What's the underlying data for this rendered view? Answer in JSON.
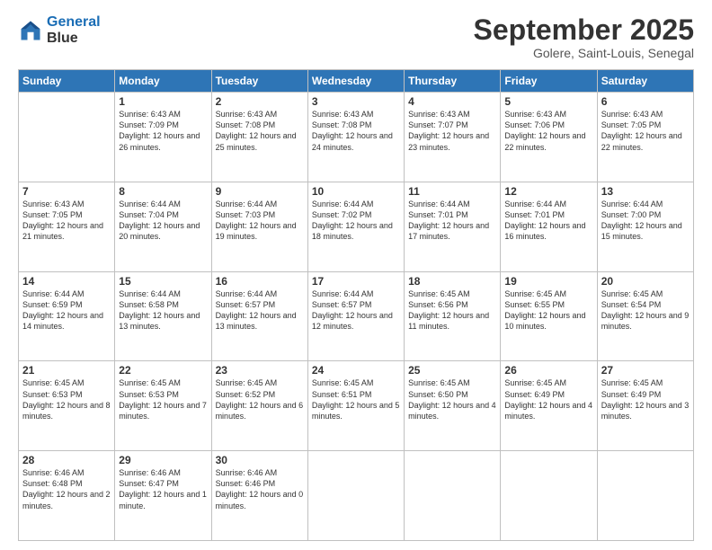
{
  "logo": {
    "line1": "General",
    "line2": "Blue"
  },
  "title": "September 2025",
  "subtitle": "Golere, Saint-Louis, Senegal",
  "days_of_week": [
    "Sunday",
    "Monday",
    "Tuesday",
    "Wednesday",
    "Thursday",
    "Friday",
    "Saturday"
  ],
  "weeks": [
    [
      {
        "day": "",
        "sunrise": "",
        "sunset": "",
        "daylight": ""
      },
      {
        "day": "1",
        "sunrise": "Sunrise: 6:43 AM",
        "sunset": "Sunset: 7:09 PM",
        "daylight": "Daylight: 12 hours and 26 minutes."
      },
      {
        "day": "2",
        "sunrise": "Sunrise: 6:43 AM",
        "sunset": "Sunset: 7:08 PM",
        "daylight": "Daylight: 12 hours and 25 minutes."
      },
      {
        "day": "3",
        "sunrise": "Sunrise: 6:43 AM",
        "sunset": "Sunset: 7:08 PM",
        "daylight": "Daylight: 12 hours and 24 minutes."
      },
      {
        "day": "4",
        "sunrise": "Sunrise: 6:43 AM",
        "sunset": "Sunset: 7:07 PM",
        "daylight": "Daylight: 12 hours and 23 minutes."
      },
      {
        "day": "5",
        "sunrise": "Sunrise: 6:43 AM",
        "sunset": "Sunset: 7:06 PM",
        "daylight": "Daylight: 12 hours and 22 minutes."
      },
      {
        "day": "6",
        "sunrise": "Sunrise: 6:43 AM",
        "sunset": "Sunset: 7:05 PM",
        "daylight": "Daylight: 12 hours and 22 minutes."
      }
    ],
    [
      {
        "day": "7",
        "sunrise": "Sunrise: 6:43 AM",
        "sunset": "Sunset: 7:05 PM",
        "daylight": "Daylight: 12 hours and 21 minutes."
      },
      {
        "day": "8",
        "sunrise": "Sunrise: 6:44 AM",
        "sunset": "Sunset: 7:04 PM",
        "daylight": "Daylight: 12 hours and 20 minutes."
      },
      {
        "day": "9",
        "sunrise": "Sunrise: 6:44 AM",
        "sunset": "Sunset: 7:03 PM",
        "daylight": "Daylight: 12 hours and 19 minutes."
      },
      {
        "day": "10",
        "sunrise": "Sunrise: 6:44 AM",
        "sunset": "Sunset: 7:02 PM",
        "daylight": "Daylight: 12 hours and 18 minutes."
      },
      {
        "day": "11",
        "sunrise": "Sunrise: 6:44 AM",
        "sunset": "Sunset: 7:01 PM",
        "daylight": "Daylight: 12 hours and 17 minutes."
      },
      {
        "day": "12",
        "sunrise": "Sunrise: 6:44 AM",
        "sunset": "Sunset: 7:01 PM",
        "daylight": "Daylight: 12 hours and 16 minutes."
      },
      {
        "day": "13",
        "sunrise": "Sunrise: 6:44 AM",
        "sunset": "Sunset: 7:00 PM",
        "daylight": "Daylight: 12 hours and 15 minutes."
      }
    ],
    [
      {
        "day": "14",
        "sunrise": "Sunrise: 6:44 AM",
        "sunset": "Sunset: 6:59 PM",
        "daylight": "Daylight: 12 hours and 14 minutes."
      },
      {
        "day": "15",
        "sunrise": "Sunrise: 6:44 AM",
        "sunset": "Sunset: 6:58 PM",
        "daylight": "Daylight: 12 hours and 13 minutes."
      },
      {
        "day": "16",
        "sunrise": "Sunrise: 6:44 AM",
        "sunset": "Sunset: 6:57 PM",
        "daylight": "Daylight: 12 hours and 13 minutes."
      },
      {
        "day": "17",
        "sunrise": "Sunrise: 6:44 AM",
        "sunset": "Sunset: 6:57 PM",
        "daylight": "Daylight: 12 hours and 12 minutes."
      },
      {
        "day": "18",
        "sunrise": "Sunrise: 6:45 AM",
        "sunset": "Sunset: 6:56 PM",
        "daylight": "Daylight: 12 hours and 11 minutes."
      },
      {
        "day": "19",
        "sunrise": "Sunrise: 6:45 AM",
        "sunset": "Sunset: 6:55 PM",
        "daylight": "Daylight: 12 hours and 10 minutes."
      },
      {
        "day": "20",
        "sunrise": "Sunrise: 6:45 AM",
        "sunset": "Sunset: 6:54 PM",
        "daylight": "Daylight: 12 hours and 9 minutes."
      }
    ],
    [
      {
        "day": "21",
        "sunrise": "Sunrise: 6:45 AM",
        "sunset": "Sunset: 6:53 PM",
        "daylight": "Daylight: 12 hours and 8 minutes."
      },
      {
        "day": "22",
        "sunrise": "Sunrise: 6:45 AM",
        "sunset": "Sunset: 6:53 PM",
        "daylight": "Daylight: 12 hours and 7 minutes."
      },
      {
        "day": "23",
        "sunrise": "Sunrise: 6:45 AM",
        "sunset": "Sunset: 6:52 PM",
        "daylight": "Daylight: 12 hours and 6 minutes."
      },
      {
        "day": "24",
        "sunrise": "Sunrise: 6:45 AM",
        "sunset": "Sunset: 6:51 PM",
        "daylight": "Daylight: 12 hours and 5 minutes."
      },
      {
        "day": "25",
        "sunrise": "Sunrise: 6:45 AM",
        "sunset": "Sunset: 6:50 PM",
        "daylight": "Daylight: 12 hours and 4 minutes."
      },
      {
        "day": "26",
        "sunrise": "Sunrise: 6:45 AM",
        "sunset": "Sunset: 6:49 PM",
        "daylight": "Daylight: 12 hours and 4 minutes."
      },
      {
        "day": "27",
        "sunrise": "Sunrise: 6:45 AM",
        "sunset": "Sunset: 6:49 PM",
        "daylight": "Daylight: 12 hours and 3 minutes."
      }
    ],
    [
      {
        "day": "28",
        "sunrise": "Sunrise: 6:46 AM",
        "sunset": "Sunset: 6:48 PM",
        "daylight": "Daylight: 12 hours and 2 minutes."
      },
      {
        "day": "29",
        "sunrise": "Sunrise: 6:46 AM",
        "sunset": "Sunset: 6:47 PM",
        "daylight": "Daylight: 12 hours and 1 minute."
      },
      {
        "day": "30",
        "sunrise": "Sunrise: 6:46 AM",
        "sunset": "Sunset: 6:46 PM",
        "daylight": "Daylight: 12 hours and 0 minutes."
      },
      {
        "day": "",
        "sunrise": "",
        "sunset": "",
        "daylight": ""
      },
      {
        "day": "",
        "sunrise": "",
        "sunset": "",
        "daylight": ""
      },
      {
        "day": "",
        "sunrise": "",
        "sunset": "",
        "daylight": ""
      },
      {
        "day": "",
        "sunrise": "",
        "sunset": "",
        "daylight": ""
      }
    ]
  ]
}
